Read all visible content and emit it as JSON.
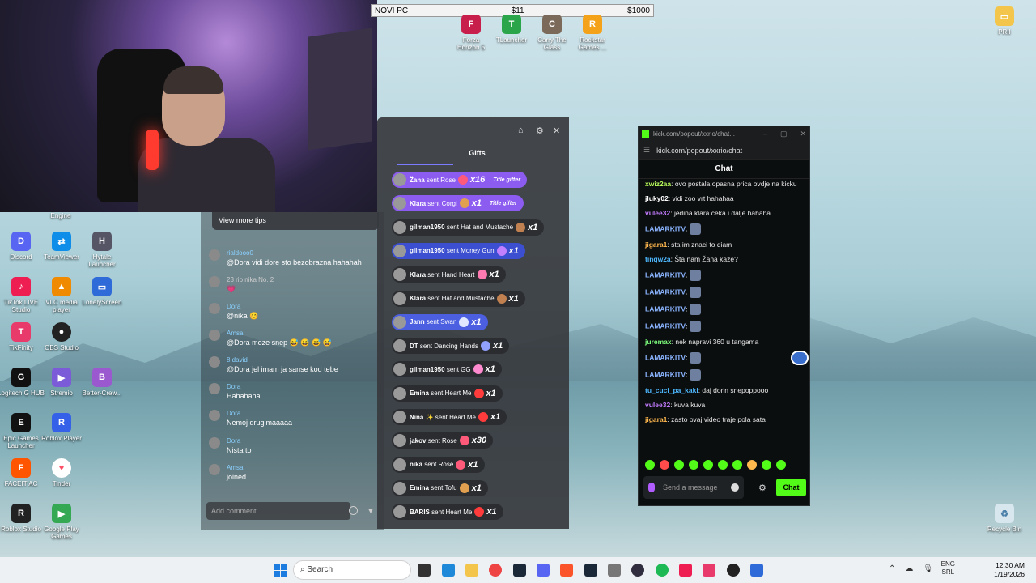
{
  "topbar": {
    "left": "NOVI PC",
    "mid": "$11",
    "right": "$1000"
  },
  "top_apps": [
    {
      "label": "Forza Horizon 5",
      "color": "#c81e4b"
    },
    {
      "label": "TLauncher",
      "color": "#2aa54a"
    },
    {
      "label": "Carry The Glass",
      "color": "#7b6a5a"
    },
    {
      "label": "Rockstar Games ...",
      "color": "#f4a21a"
    }
  ],
  "desktop_right": {
    "prii": "PRII",
    "recycle": "Recycle Bin"
  },
  "desktop_icons": [
    {
      "label": "Engine"
    },
    {
      "label": "Discord"
    },
    {
      "label": "TeamViewer"
    },
    {
      "label": "Hytale Launcher"
    },
    {
      "label": "TikTok LIVE Studio"
    },
    {
      "label": "VLC media player"
    },
    {
      "label": "LonelyScreen"
    },
    {
      "label": "TikFinity"
    },
    {
      "label": "OBS Studio"
    },
    {
      "label": "Logitech G HUB"
    },
    {
      "label": "Stremio"
    },
    {
      "label": "Better-Crew..."
    },
    {
      "label": "Epic Games Launcher"
    },
    {
      "label": "Roblox Player"
    },
    {
      "label": "FACEIT AC"
    },
    {
      "label": "Tinder"
    },
    {
      "label": "Roblox Studio"
    },
    {
      "label": "Google Play Games"
    }
  ],
  "tiktok": {
    "tips_button": "View more tips",
    "comments": [
      {
        "user": "rialdooo0",
        "text": "@Dora vidi dore sto bezobrazna hahahah"
      },
      {
        "user": "23  rio  nika  No. 2",
        "text": "💗"
      },
      {
        "user": "Dora",
        "text": "@nika 😊"
      },
      {
        "user": "Amsal",
        "text": "@Dora moze snep 😅 😅 😅 😅"
      },
      {
        "user": "8  david",
        "text": "@Dora jel imam ja sanse kod tebe"
      },
      {
        "user": "Dora",
        "text": "Hahahaha"
      },
      {
        "user": "Dora",
        "text": "Nemoj drugimaaaaa"
      },
      {
        "user": "Dora",
        "text": "Nista to"
      },
      {
        "user": "Amsal",
        "text": "joined"
      }
    ],
    "comment_placeholder": "Add comment"
  },
  "gifts": {
    "title": "Gifts",
    "rows": [
      {
        "name": "Žana",
        "text": "sent Rose",
        "count": "x16",
        "tag": "Title gifter",
        "bg": "#8c5cf0",
        "gift": "#ff5a7a"
      },
      {
        "name": "Klara",
        "text": "sent Corgi",
        "count": "x1",
        "tag": "Title gifter",
        "bg": "#8c5cf0",
        "gift": "#e0a050"
      },
      {
        "name": "gilman1950",
        "text": "sent Hat and Mustache",
        "count": "x1",
        "tag": "",
        "bg": "rgba(30,30,34,0.6)",
        "gift": "#c08050"
      },
      {
        "name": "gilman1950",
        "text": "sent Money Gun",
        "count": "x1",
        "tag": "",
        "bg": "#3b4fd0",
        "gift": "#c080ff"
      },
      {
        "name": "Klara",
        "text": "sent Hand Heart",
        "count": "x1",
        "tag": "",
        "bg": "rgba(30,30,34,0.6)",
        "gift": "#ff7ab0"
      },
      {
        "name": "Klara",
        "text": "sent Hat and Mustache",
        "count": "x1",
        "tag": "",
        "bg": "rgba(30,30,34,0.6)",
        "gift": "#c08050"
      },
      {
        "name": "Jann",
        "text": "sent Swan",
        "count": "x1",
        "tag": "",
        "bg": "#4b5fe0",
        "gift": "#dfe8ff"
      },
      {
        "name": "DT",
        "text": "sent Dancing Hands",
        "count": "x1",
        "tag": "",
        "bg": "rgba(30,30,34,0.6)",
        "gift": "#8fa0ff"
      },
      {
        "name": "gilman1950",
        "text": "sent GG",
        "count": "x1",
        "tag": "",
        "bg": "rgba(30,30,34,0.6)",
        "gift": "#ff8ad0"
      },
      {
        "name": "Emina",
        "text": "sent Heart Me",
        "count": "x1",
        "tag": "",
        "bg": "rgba(30,30,34,0.6)",
        "gift": "#ff3b3b"
      },
      {
        "name": "Nina ✨",
        "text": "sent Heart Me",
        "count": "x1",
        "tag": "",
        "bg": "rgba(30,30,34,0.6)",
        "gift": "#ff3b3b"
      },
      {
        "name": "jakov",
        "text": "sent Rose",
        "count": "x30",
        "tag": "",
        "bg": "rgba(30,30,34,0.6)",
        "gift": "#ff5a7a"
      },
      {
        "name": "nika",
        "text": "sent Rose",
        "count": "x1",
        "tag": "",
        "bg": "rgba(30,30,34,0.6)",
        "gift": "#ff5a7a"
      },
      {
        "name": "Emina",
        "text": "sent Tofu",
        "count": "x1",
        "tag": "",
        "bg": "rgba(30,30,34,0.6)",
        "gift": "#e0a050"
      },
      {
        "name": "BARIS",
        "text": "sent Heart Me",
        "count": "x1",
        "tag": "",
        "bg": "rgba(30,30,34,0.6)",
        "gift": "#ff3b3b"
      }
    ]
  },
  "kick": {
    "window_title": "kick.com/popout/xxrio/chat...",
    "url": "kick.com/popout/xxrio/chat",
    "header": "Chat",
    "messages": [
      {
        "user": "xwiz2aa",
        "text": "ovo postala opasna prica ovdje na kicku",
        "color": "#b5f75a"
      },
      {
        "user": "jluky02",
        "text": "vidi zoo vrt hahahaa",
        "color": "#ffffff"
      },
      {
        "user": "vulee32",
        "text": "jedina klara ceka i dalje hahaha",
        "color": "#c37cff"
      },
      {
        "user": "LAMARKITV",
        "text": "",
        "color": "#8ab4ff"
      },
      {
        "user": "jigara1",
        "text": "sta im znaci to diam",
        "color": "#ffb84d"
      },
      {
        "user": "tinqw2a",
        "text": "Šta nam Žana kaže?",
        "color": "#4db8ff"
      },
      {
        "user": "LAMARKITV",
        "text": "",
        "color": "#8ab4ff"
      },
      {
        "user": "LAMARKITV",
        "text": "",
        "color": "#8ab4ff"
      },
      {
        "user": "LAMARKITV",
        "text": "",
        "color": "#8ab4ff"
      },
      {
        "user": "LAMARKITV",
        "text": "",
        "color": "#8ab4ff"
      },
      {
        "user": "juremax",
        "text": "nek napravi 360 u tangama",
        "color": "#7dff7d"
      },
      {
        "user": "LAMARKITV",
        "text": "",
        "color": "#8ab4ff"
      },
      {
        "user": "LAMARKITV",
        "text": "",
        "color": "#8ab4ff"
      },
      {
        "user": "tu_cuci_pa_kaki",
        "text": "daj dorin snepoppooo",
        "color": "#4db8ff"
      },
      {
        "user": "vulee32",
        "text": "kuva kuva",
        "color": "#c37cff"
      },
      {
        "user": "jigara1",
        "text": "zasto ovaj video traje pola sata",
        "color": "#ffb84d"
      }
    ],
    "input_placeholder": "Send a message",
    "send_label": "Chat"
  },
  "taskbar": {
    "search": "Search",
    "lang1": "ENG",
    "lang2": "SRL",
    "time": "12:30 AM",
    "date": "1/19/2026"
  }
}
